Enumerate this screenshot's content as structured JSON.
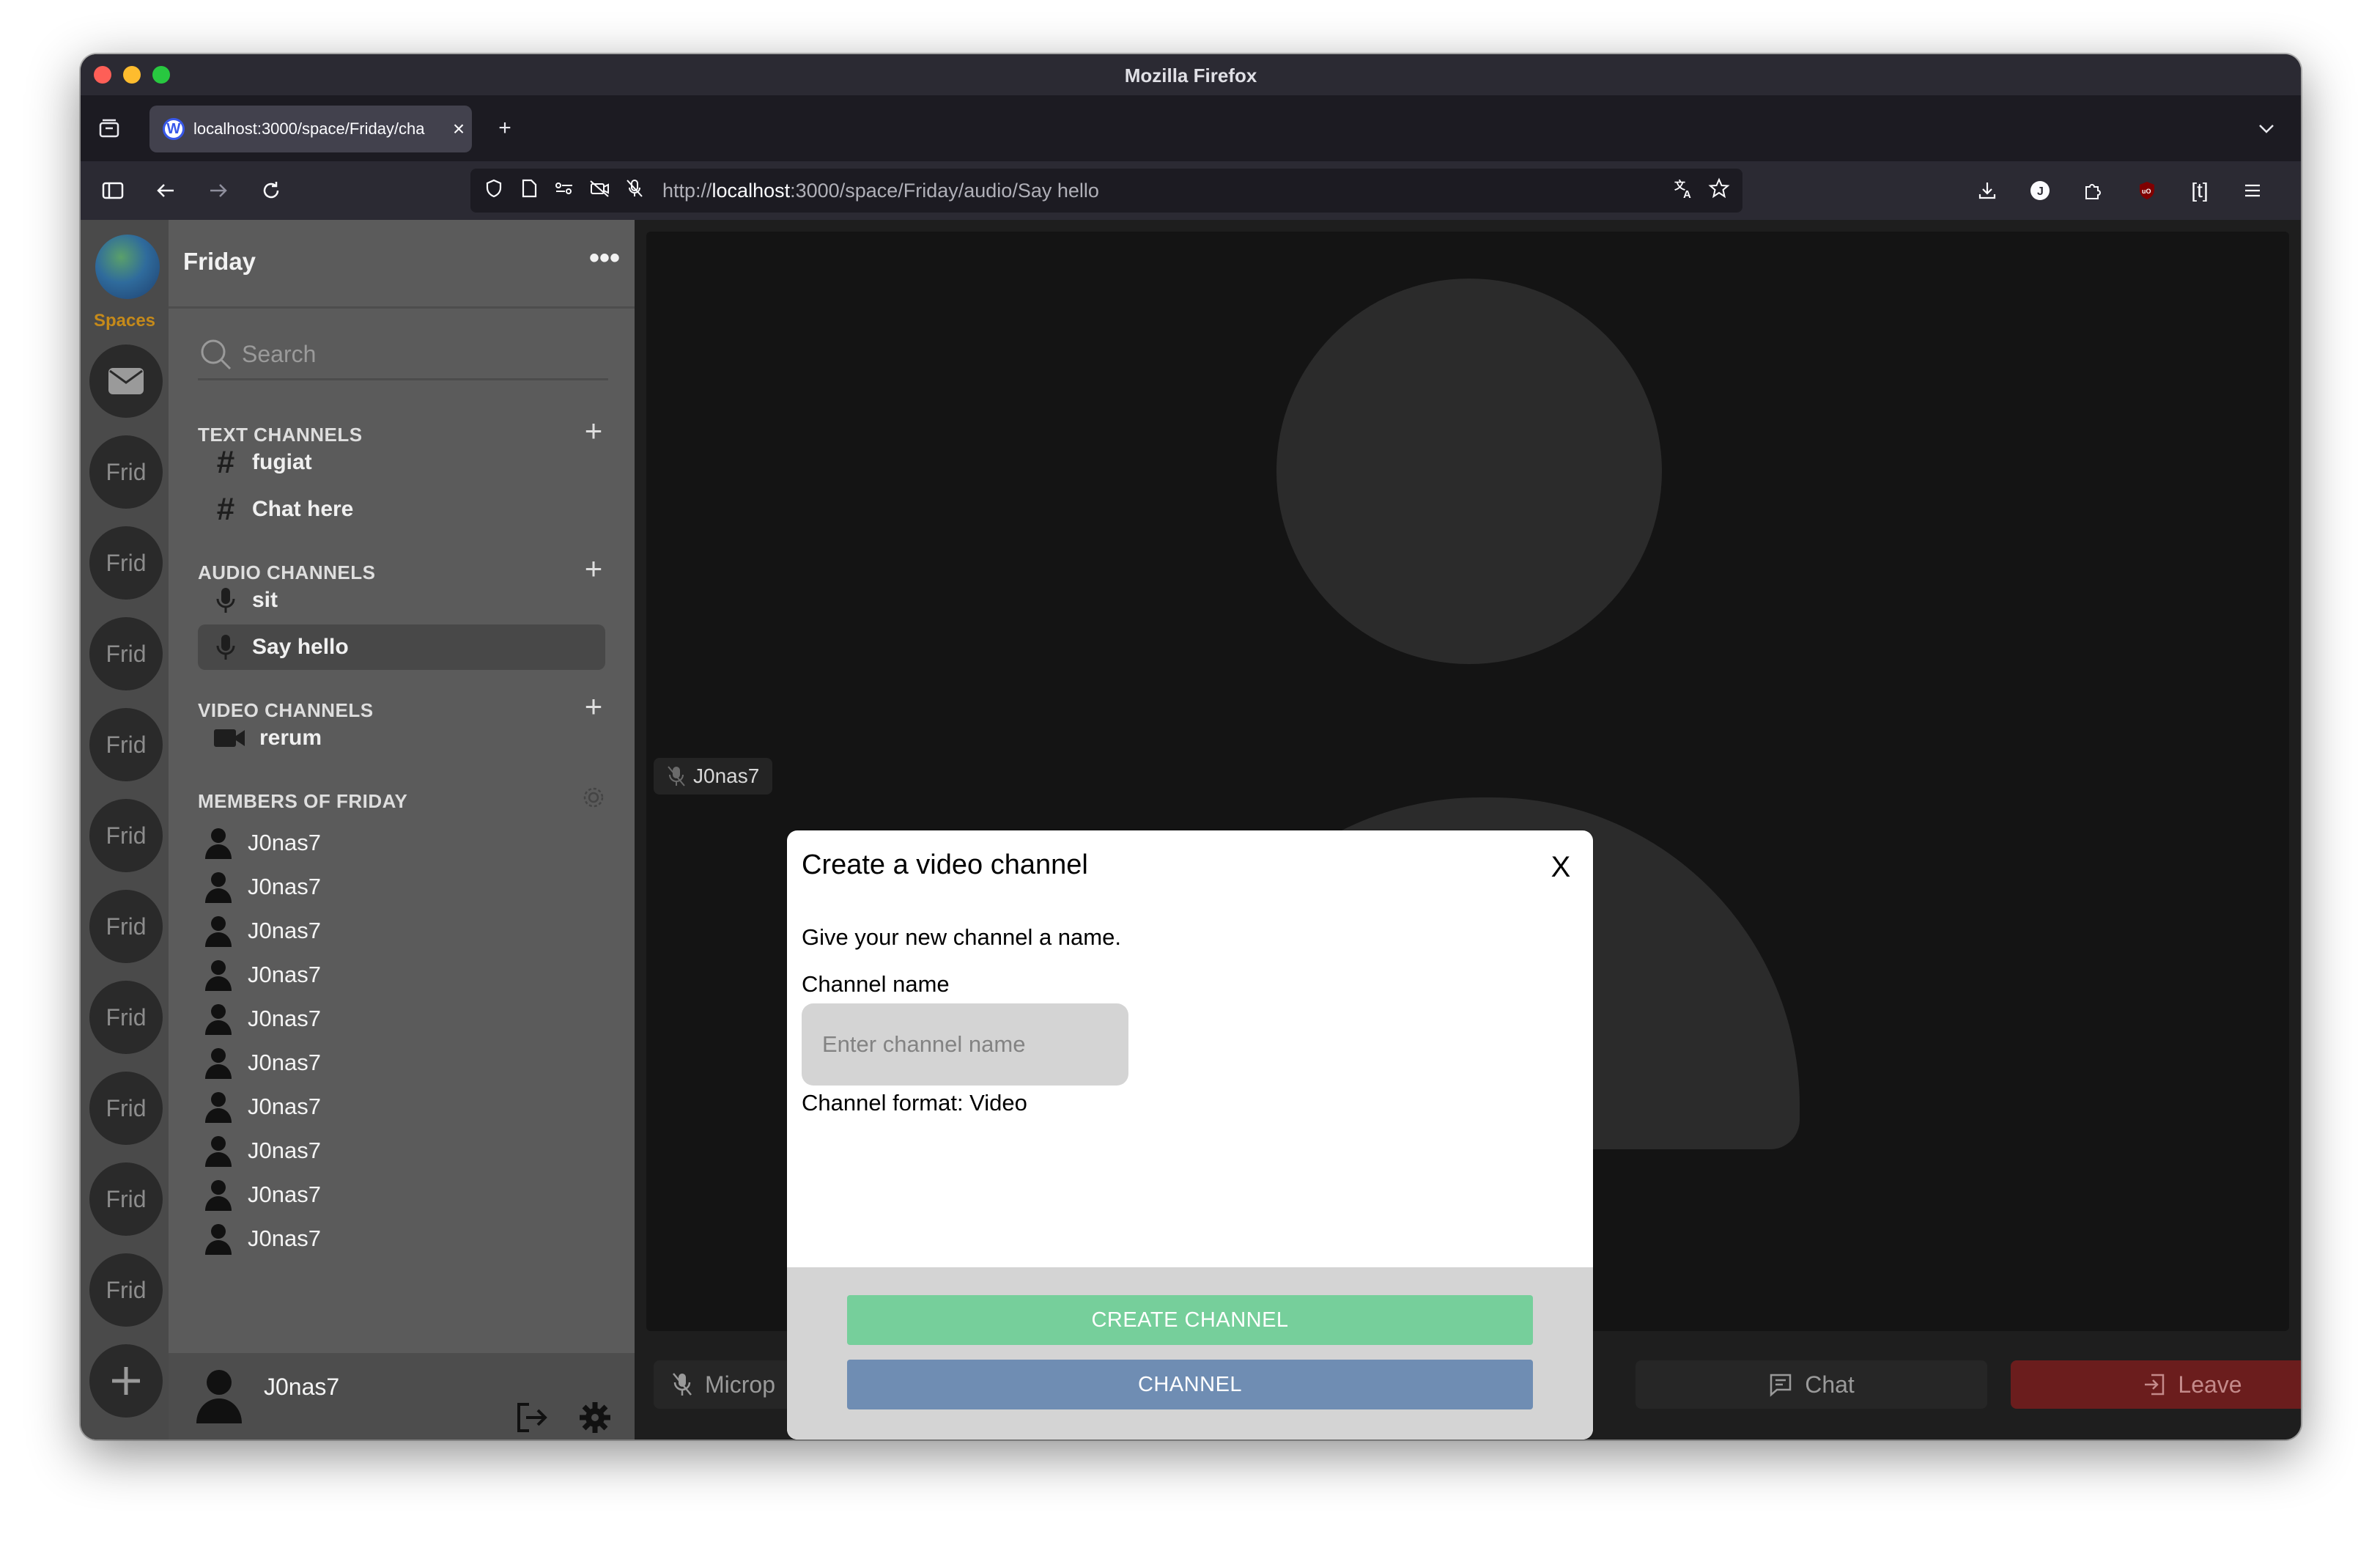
{
  "browser": {
    "window_title": "Mozilla Firefox",
    "tab_title": "localhost:3000/space/Friday/cha",
    "url_prefix": "http://",
    "url_host": "localhost",
    "url_rest": ":3000/space/Friday/audio/Say hello"
  },
  "spaces": {
    "label": "Spaces",
    "items": [
      "Frid",
      "Frid",
      "Frid",
      "Frid",
      "Frid",
      "Frid",
      "Frid",
      "Frid",
      "Frid",
      "Frid"
    ]
  },
  "space": {
    "name": "Friday",
    "search_placeholder": "Search",
    "text_channels_title": "TEXT CHANNELS",
    "text_channels": [
      "fugiat",
      "Chat here"
    ],
    "audio_channels_title": "AUDIO CHANNELS",
    "audio_channels": [
      "sit",
      "Say hello"
    ],
    "video_channels_title": "VIDEO CHANNELS",
    "video_channels": [
      "rerum"
    ],
    "members_title": "MEMBERS OF FRIDAY",
    "members": [
      "J0nas7",
      "J0nas7",
      "J0nas7",
      "J0nas7",
      "J0nas7",
      "J0nas7",
      "J0nas7",
      "J0nas7",
      "J0nas7",
      "J0nas7"
    ]
  },
  "current_user": {
    "name": "J0nas7"
  },
  "call": {
    "participant": "J0nas7",
    "mic_label": "Microp",
    "chat_label": "Chat",
    "leave_label": "Leave"
  },
  "modal": {
    "title": "Create a video channel",
    "close": "X",
    "description": "Give your new channel a name.",
    "name_label": "Channel name",
    "name_placeholder": "Enter channel name",
    "name_value": "",
    "format_text": "Channel format: Video",
    "create_button": "CREATE CHANNEL",
    "secondary_button": "CHANNEL"
  },
  "colors": {
    "create_button": "#76cf9b",
    "secondary_button": "#6f8db3",
    "leave_button": "#6b1d1d",
    "spaces_label": "#c58a1a"
  }
}
